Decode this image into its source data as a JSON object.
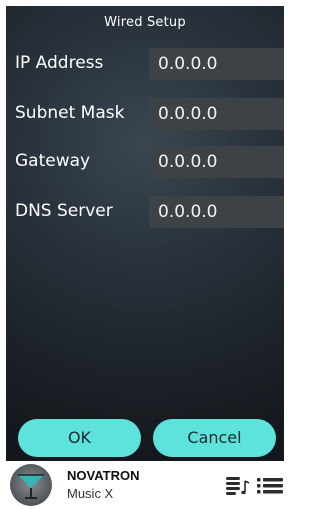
{
  "header": {
    "title": "Wired Setup"
  },
  "fields": [
    {
      "label": "IP Address",
      "value": "0.0.0.0"
    },
    {
      "label": "Subnet Mask",
      "value": "0.0.0.0"
    },
    {
      "label": "Gateway",
      "value": "0.0.0.0"
    },
    {
      "label": "DNS Server",
      "value": "0.0.0.0"
    }
  ],
  "actions": {
    "ok_label": "OK",
    "cancel_label": "Cancel"
  },
  "now_playing": {
    "title": "NOVATRON",
    "subtitle": "Music X",
    "artwork_icon": "cocktail-glass-icon",
    "queue_icon": "music-queue-icon",
    "list_icon": "list-icon"
  },
  "colors": {
    "accent": "#5de2dc",
    "field_bg": "#3d4247",
    "screen_bg": "#28313a"
  }
}
